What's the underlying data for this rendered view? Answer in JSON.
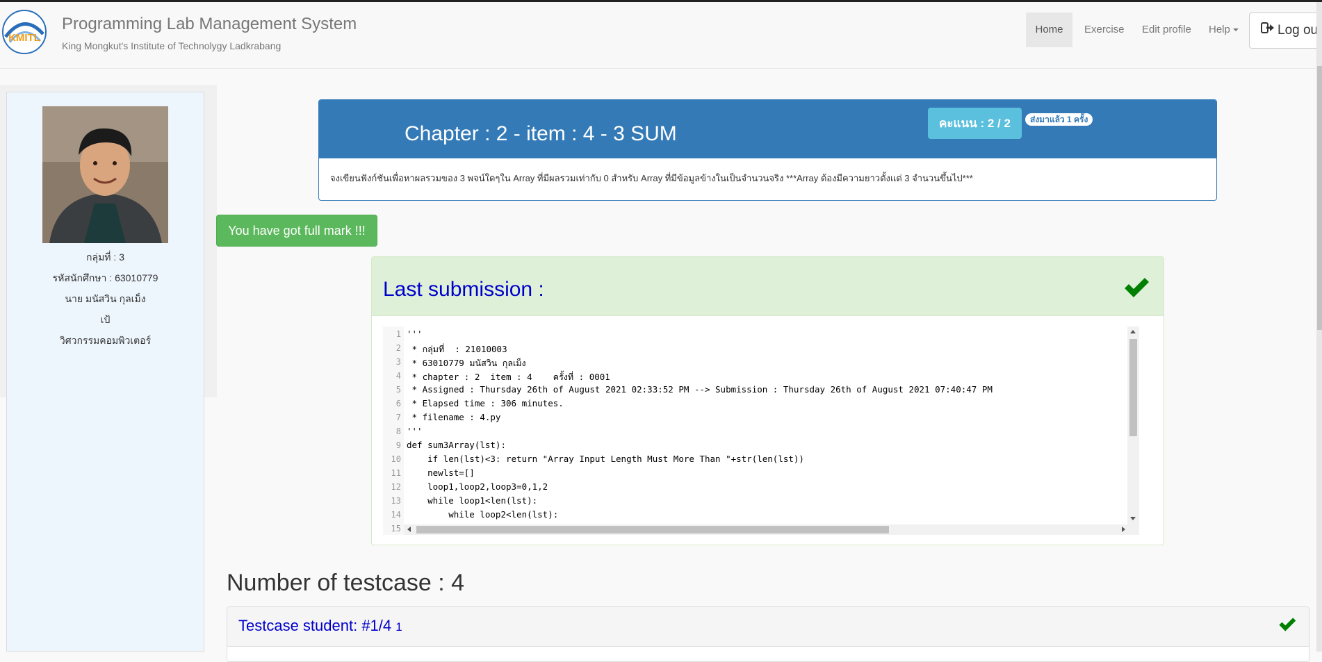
{
  "app": {
    "title": "Programming Lab Management System",
    "subtitle": "King Mongkut's Institute of Technolygy Ladkrabang",
    "logo_text": "KMITL"
  },
  "nav": {
    "home": "Home",
    "exercise": "Exercise",
    "edit_profile": "Edit profile",
    "help": "Help",
    "logout": "Log out"
  },
  "student": {
    "group": "กลุ่มที่ : 3",
    "student_id": "รหัสนักศึกษา : 63010779",
    "name": "นาย มนัสวิน กุลเม็ง",
    "nickname": "เป้",
    "department": "วิศวกรรมคอมพิวเตอร์"
  },
  "chapter": {
    "title": "Chapter : 2 - item : 4 - 3 SUM",
    "score": "คะแนน : 2 / 2",
    "sent_badge": "ส่งมาแล้ว 1 ครั้ง",
    "description": "จงเขียนฟังก์ชันเพื่อหาผลรวมของ 3 พจน์ใดๆใน Array ที่มีผลรวมเท่ากับ 0 สำหรับ Array ที่มีข้อมูลข้างในเป็นจำนวนจริง ***Array ต้องมีความยาวตั้งแต่ 3 จำนวนขึ้นไป***"
  },
  "full_mark_button": "You have got full mark !!!",
  "submission": {
    "title": "Last submission :",
    "line_numbers": [
      "1",
      "2",
      "3",
      "4",
      "5",
      "6",
      "7",
      "8",
      "9",
      "10",
      "11",
      "12",
      "13",
      "14",
      "15"
    ],
    "code_lines": [
      "'''",
      " * กลุ่มที่  : 21010003",
      " * 63010779 มนัสวิน กุลเม็ง",
      " * chapter : 2  item : 4    ครั้งที่ : 0001",
      " * Assigned : Thursday 26th of August 2021 02:33:52 PM --> Submission : Thursday 26th of August 2021 07:40:47 PM",
      " * Elapsed time : 306 minutes.",
      " * filename : 4.py",
      "'''",
      "def sum3Array(lst):",
      "    if len(lst)<3: return \"Array Input Length Must More Than \"+str(len(lst))",
      "    newlst=[]",
      "    loop1,loop2,loop3=0,1,2",
      "    while loop1<len(lst):",
      "        while loop2<len(lst):",
      ""
    ]
  },
  "testcases": {
    "heading": "Number of testcase : 4",
    "first_title": "Testcase student: #1/4",
    "first_count": "1"
  },
  "colors": {
    "primary": "#337ab7",
    "success": "#5cb85c",
    "info": "#5bc0de",
    "link_blue": "#0000cc",
    "check_green": "#008000"
  }
}
